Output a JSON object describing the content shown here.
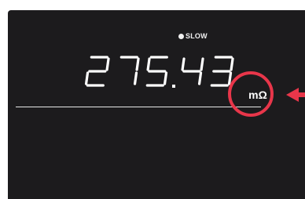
{
  "display": {
    "mode_indicator": "SLOW",
    "reading": "275.43",
    "unit": "mΩ"
  },
  "colors": {
    "panel": "#1c1b1d",
    "segment": "#ffffff",
    "highlight": "#e8364a"
  },
  "annotation": {
    "highlight_target": "unit",
    "marker": "arrow-pointing-left"
  }
}
